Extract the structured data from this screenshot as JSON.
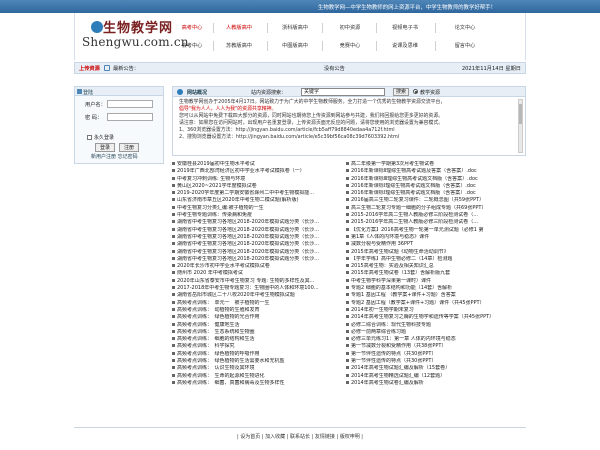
{
  "topbar": {
    "slogan": "生物教学网—中学生物教师的网上资源平台，中学生物教师的教学好帮手！"
  },
  "header": {
    "logo_cn": "生物教学网",
    "logo_en": "Shengwu.com.cn",
    "nav_row1": [
      "高考中心",
      "人教版高中",
      "浙科版高中",
      "初中资源",
      "视频电子书",
      "论文中心"
    ],
    "nav_row2": [
      "会考中心",
      "苏教版高中",
      "中图版高中",
      "竞赛中心",
      "说课及思维",
      "留言中心"
    ],
    "nav_row1_red": [
      true,
      true,
      false,
      false,
      false,
      false
    ]
  },
  "bar": {
    "upload_label": "上传资源",
    "notice_label": "最新公告：",
    "announcement": "没有公告",
    "date": "2021年11月14日 星期日"
  },
  "login": {
    "title": "登陆",
    "username_label": "用户名：",
    "password_label": "密   码：",
    "remember_label": "永久登录",
    "login_button": "登录",
    "register_button": "注册",
    "links": "新用户注册  忘记密码"
  },
  "news": {
    "title": "网站概况",
    "search_label": "站内资源搜索：",
    "search_placeholder": "关键字",
    "search_button": "搜索",
    "radio_label": "教学资源",
    "body": [
      "生物教学网创办于2005年4月17日。网站致力于为广大的中学生物教师服务，全力打造一个优秀的生物教学资源交流平台，",
      "倡导\"我为人人，人人为我\"的资源共享精神。",
      "您可以从网站中免费下载四大部分的资源，同时网站也期待您上传资源到网站参与共建，我们将回报给您更多更好的资源。",
      "请注意：如果您在访问网站时，出现用户名重复登录，上传资源页面无反应的问题，请将您使用的浏览器设置为兼容模式。",
      "1、360浏览器设置方法：http://jingyan.baidu.com/article/fcb5aff79d8840edaa4a712f.html",
      "2、搜狗浏览器设置方法：http://jingyan.baidu.com/article/e5c39bf56ca08c39d7603392.html"
    ]
  },
  "list_left": [
    "安徽桂县2019届初中生物水平考试",
    "2019年广西北部湾经济区初中学业水平考试模拟卷（一）",
    "中考复习冲刺训练: 生物与环境",
    "黄山区2020~2021学年度模拟试卷",
    "2019-2020学年度第二学期安徽省滁州二中中考生物模拟能...",
    "山东省济南市章丘区2020年中考生物二模试题(解析版)",
    "中考生物复习分类汇编:被子植物的一生",
    "中考生物专题训练：传染病和免疫",
    "湖南省中考生物复习各地区2018-2020年模拟试题分类（长沙...",
    "湖南省中考生物复习各地区2018-2020年模拟试题分类（长沙...",
    "湖南省中考生物复习各地区2018-2020年模拟试题分类（长沙...",
    "湖南省中考生物复习各地区2018-2020年模拟试题分类（长沙...",
    "湖南省中考生物复习各地区2018-2020年模拟试题分类（长沙...",
    "湖南省中考生物复习各地区2018-2020年模拟试题分类（长沙...",
    "2020年长沙市初中学业水平考试模拟试卷",
    "随州市 2020 年中考模拟考试",
    "2020年山东省泰安市中考生物复习 专题: 生物的多样性及其...",
    "2017-2018年中考生物专题复习：生物圈中的人体和环境100...",
    "湖南省岳阳市城区二十八校2020年中考生物模拟试题",
    "高频考点训练：　单元一　被子植物的一生",
    "高频考点训练：　动植物的生殖和发育",
    "高频考点训练：　绿色植物的光合作用",
    "高频考点训练：　健康地生活",
    "高频考点训练：　生态系统和生物圈",
    "高频考点训练：　细胞的结构和生活",
    "高频考点训练：　科学探究",
    "高频考点训练：　绿色植物的呼吸作用",
    "高频考点训练：　绿色植物的生活需要水和无机盐",
    "高频考点训练：　认识生物及其环境",
    "高频考点训练：　生命的起源和生物进化",
    "高频考点训练：　细菌、真菌和病毒及生物多样性"
  ],
  "list_right": [
    "高二年级第一学期第3次月考生物试卷",
    "2016年新课标Ⅱ理综生物高考试题及答案（含答案）.doc",
    "2016年新课标Ⅲ理综生物高考试题文档版（含答案）.doc",
    "2016年新课标Ⅰ理综生物高考试题文档版（含答案）.doc",
    "2016年新课标Ⅰ理综生物高考试题文档版（含答案）.doc",
    "2016届高三生物二轮复习课件：二轮概念图（共59张PPT）",
    "高三生物二轮复习专题一细胞的分子组成专题（共69张PPT）",
    "2015-2016学年高二生物人教版必修三阶段检测试卷（...",
    "2015-2016学年高二生物人教版必修三阶段检测试卷（...",
    "【优化方案】2016高考生物一轮第一单元测试题（必修1 第",
    "第1章《人体的内环境与稳态》课件",
    "减数分裂与受精作用 36PPT",
    "2015年高考生物试题《动物生命活动调节》",
    "【学年学练】高中生物必修二（14章）检测题",
    "2015高考生物：实验及相关知识汇总",
    "2015年高考生物试卷（13套）含解析版九套",
    "中考生物学科学深果第一课时）课件",
    "专题2 细胞的基本结构和功能（14套）含解析",
    "专题1 基因工程 （教学案+课件+习题）含答案",
    "专题2 基因工程（教学案+课件+习题）课件（共45张PPT）",
    "2014年初一生物学期末复习",
    "2014年高考生物复习之酶的生物学和遗传等学案（共45张PPT）",
    "必修二综合训练：现代生物科技专题",
    "必修一前两章综合练习题",
    "必修三单元练习1：第一章 人体的内环境与稳态",
    "第一节减数分裂和受精作用（共38张PPT）",
    "第一节伴性遗传的特点（共30张PPT）",
    "第一节伴性遗传的特点（共30张PPT）",
    "2014年高考生物试题汇编及解析（15套卷）",
    "2014年高考生物精选试题汇编（12套题）",
    "2014年高考生物试卷汇编及解析"
  ],
  "footer": {
    "text": "| 设为首页 | 加入收藏 | 联系站长 | 友情链接 | 版权申明 |"
  }
}
